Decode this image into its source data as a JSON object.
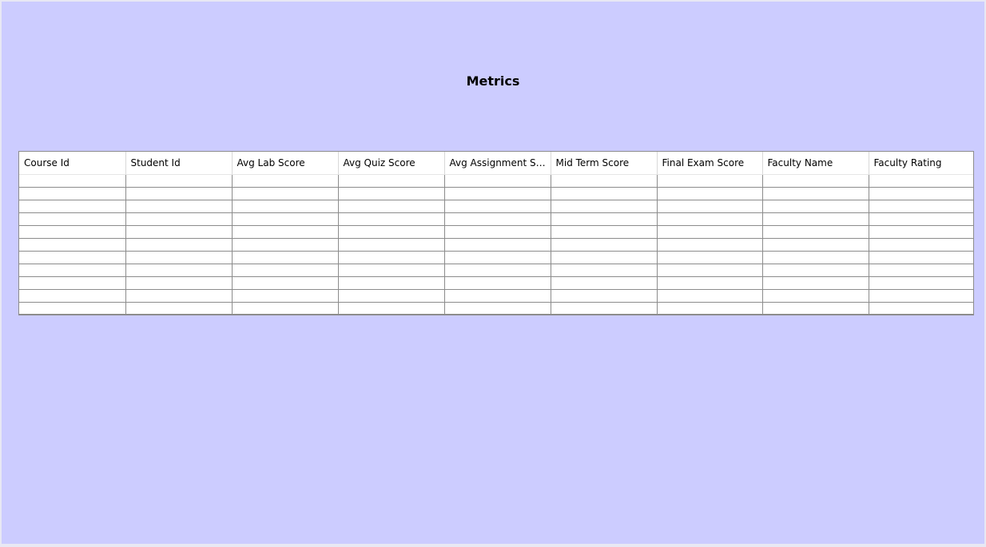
{
  "page": {
    "title": "Metrics"
  },
  "table": {
    "columns": [
      "Course Id",
      "Student Id",
      "Avg Lab Score",
      "Avg Quiz Score",
      "Avg Assignment Sc...",
      "Mid Term Score",
      "Final Exam Score",
      "Faculty Name",
      "Faculty Rating"
    ],
    "rows": [
      [
        "",
        "",
        "",
        "",
        "",
        "",
        "",
        "",
        ""
      ],
      [
        "",
        "",
        "",
        "",
        "",
        "",
        "",
        "",
        ""
      ],
      [
        "",
        "",
        "",
        "",
        "",
        "",
        "",
        "",
        ""
      ],
      [
        "",
        "",
        "",
        "",
        "",
        "",
        "",
        "",
        ""
      ],
      [
        "",
        "",
        "",
        "",
        "",
        "",
        "",
        "",
        ""
      ],
      [
        "",
        "",
        "",
        "",
        "",
        "",
        "",
        "",
        ""
      ],
      [
        "",
        "",
        "",
        "",
        "",
        "",
        "",
        "",
        ""
      ],
      [
        "",
        "",
        "",
        "",
        "",
        "",
        "",
        "",
        ""
      ],
      [
        "",
        "",
        "",
        "",
        "",
        "",
        "",
        "",
        ""
      ],
      [
        "",
        "",
        "",
        "",
        "",
        "",
        "",
        "",
        ""
      ],
      [
        "",
        "",
        "",
        "",
        "",
        "",
        "",
        "",
        ""
      ]
    ]
  },
  "colors": {
    "background": "#ccccff",
    "grid": "#8c8c8c"
  }
}
